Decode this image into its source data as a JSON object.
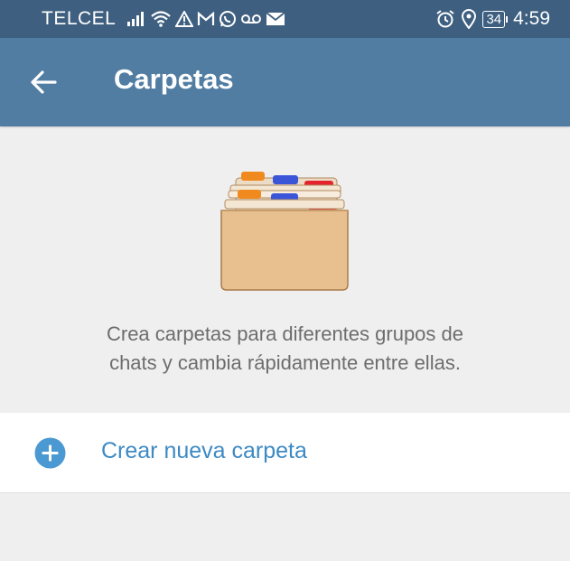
{
  "status_bar": {
    "carrier": "TELCEL",
    "battery": "34",
    "time": "4:59",
    "icons_left": [
      "signal-icon",
      "wifi-icon",
      "warning-icon",
      "gmail-icon",
      "whatsapp-icon",
      "voicemail-icon",
      "email-icon"
    ],
    "icons_right": [
      "alarm-icon",
      "location-icon",
      "battery-icon"
    ]
  },
  "app_bar": {
    "title": "Carpetas",
    "back_icon": "arrow-left-icon",
    "background": "#527da3"
  },
  "illustration": {
    "icon": "folders-illustration",
    "tab_colors": [
      "#f08a1e",
      "#3a55d8",
      "#e5232d"
    ],
    "folder_color": "#e8c08f"
  },
  "description": {
    "line1": "Crea carpetas para diferentes grupos de",
    "line2": "chats y cambia rápidamente entre ellas."
  },
  "create_folder": {
    "label": "Crear nueva carpeta",
    "icon": "plus-circle-icon",
    "accent": "#3d8ac4"
  }
}
